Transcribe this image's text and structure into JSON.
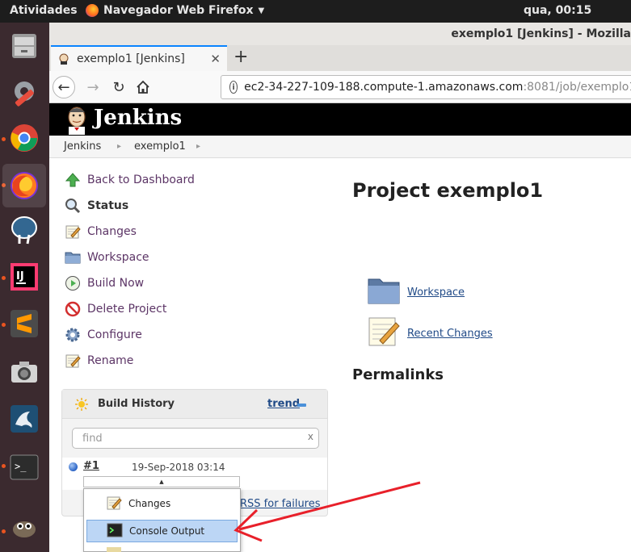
{
  "topbar": {
    "activities": "Atividades",
    "app_name": "Navegador Web Firefox",
    "clock": "qua, 00:15"
  },
  "launcher": {
    "items": [
      "file-cabinet-icon",
      "system-settings-icon",
      "chrome-icon",
      "firefox-icon",
      "postgresql-elephant-icon",
      "intellij-icon",
      "sublime-text-icon",
      "camera-icon",
      "mysql-workbench-icon",
      "terminal-icon",
      "gimp-icon"
    ]
  },
  "browser": {
    "window_title": "exemplo1 [Jenkins] - Mozilla",
    "tab_title": "exemplo1 [Jenkins]",
    "url_main": "ec2-34-227-109-188.compute-1.amazonaws.com",
    "url_rest": ":8081/job/exemplo1/"
  },
  "jenkins": {
    "logo": "Jenkins",
    "breadcrumbs": [
      "Jenkins",
      "exemplo1"
    ]
  },
  "tasks": [
    {
      "label": "Back to Dashboard",
      "icon": "up-arrow-icon"
    },
    {
      "label": "Status",
      "icon": "magnifier-icon"
    },
    {
      "label": "Changes",
      "icon": "notepad-icon"
    },
    {
      "label": "Workspace",
      "icon": "folder-icon"
    },
    {
      "label": "Build Now",
      "icon": "clock-play-icon"
    },
    {
      "label": "Delete Project",
      "icon": "no-entry-icon"
    },
    {
      "label": "Configure",
      "icon": "gear-icon"
    },
    {
      "label": "Rename",
      "icon": "notepad-icon"
    }
  ],
  "build_history": {
    "title": "Build History",
    "trend": "trend",
    "find_placeholder": "find",
    "find_clear": "x",
    "build_number": "#1",
    "build_date": "19-Sep-2018 03:14",
    "rss": "RSS for failures"
  },
  "context_menu": {
    "items": [
      {
        "label": "Changes",
        "icon": "notepad-icon"
      },
      {
        "label": "Console Output",
        "icon": "terminal-icon"
      }
    ]
  },
  "main": {
    "title": "Project exemplo1",
    "links": [
      {
        "label": "Workspace",
        "icon": "folder-icon"
      },
      {
        "label": "Recent Changes",
        "icon": "notepad-icon"
      }
    ],
    "permalinks": "Permalinks"
  },
  "colors": {
    "link_purple": "#5c3566",
    "link_blue": "#204a87",
    "annotation_arrow": "#e8202a",
    "highlight": "#bcd6f5"
  }
}
